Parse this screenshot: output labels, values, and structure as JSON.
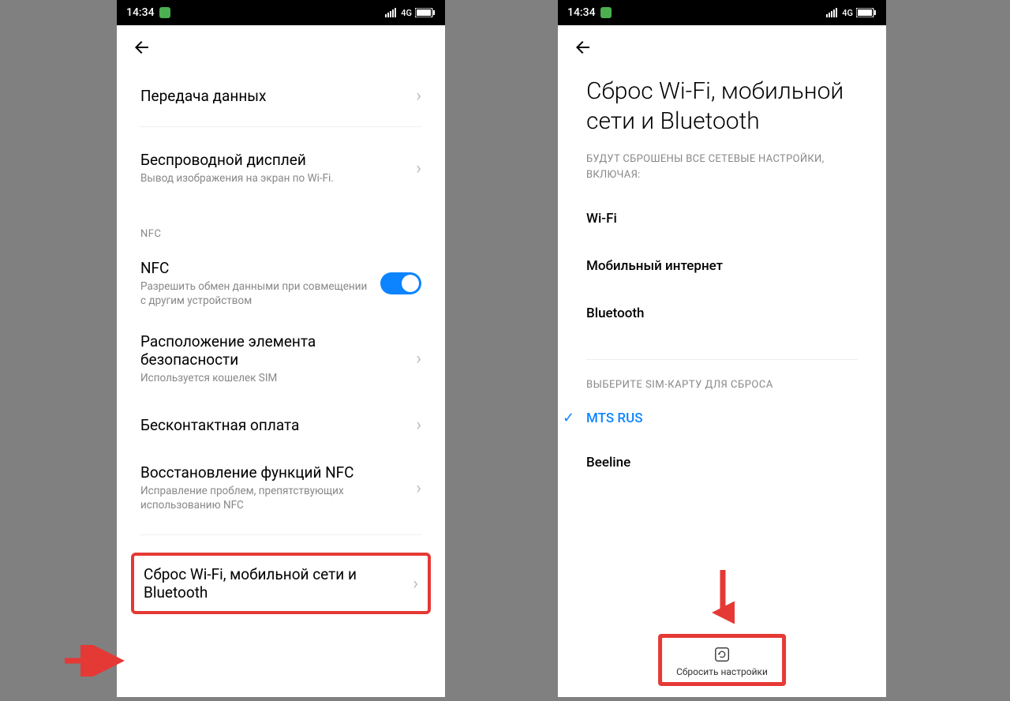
{
  "statusbar": {
    "time": "14:34",
    "network": "4G"
  },
  "left": {
    "items": {
      "data_transfer": "Передача данных",
      "wireless_display_title": "Беспроводной дисплей",
      "wireless_display_sub": "Вывод изображения на экран по Wi-Fi.",
      "nfc_section": "NFC",
      "nfc_title": "NFC",
      "nfc_sub": "Разрешить обмен данными при совмещении с другим устройством",
      "secure_element_title": "Расположение элемента безопасности",
      "secure_element_sub": "Используется кошелек SIM",
      "contactless": "Бесконтактная оплата",
      "nfc_restore_title": "Восстановление функций NFC",
      "nfc_restore_sub": "Исправление проблем, препятствующих использованию NFC",
      "reset_network": "Сброс Wi-Fi, мобильной сети и Bluetooth"
    }
  },
  "right": {
    "title": "Сброс Wi-Fi, мобильной сети и Bluetooth",
    "caption": "БУДУТ СБРОШЕНЫ ВСЕ СЕТЕВЫЕ НАСТРОЙКИ, ВКЛЮЧАЯ:",
    "bullets": {
      "wifi": "Wi-Fi",
      "mobile": "Мобильный интернет",
      "bluetooth": "Bluetooth"
    },
    "sim_caption": "ВЫБЕРИТЕ SIM-КАРТУ ДЛЯ СБРОСА",
    "sims": {
      "mts": "MTS RUS",
      "beeline": "Beeline"
    },
    "reset_btn": "Сбросить настройки"
  }
}
